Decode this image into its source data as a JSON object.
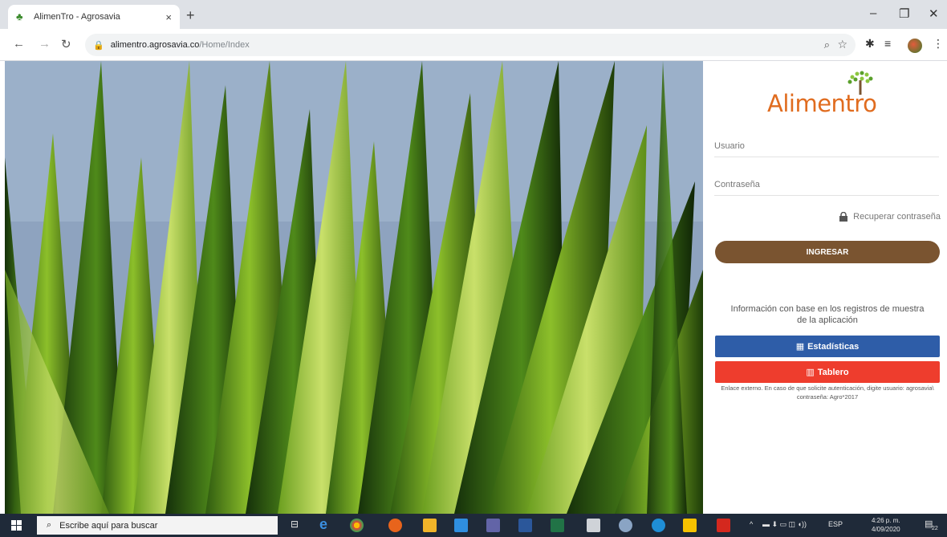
{
  "browser": {
    "tab_title": "AlimenTro - Agrosavia",
    "tab_close": "×",
    "new_tab": "+",
    "url_host": "alimentro.agrosavia.co",
    "url_path": "/Home/Index"
  },
  "login": {
    "logo_text": "Alimentro",
    "username_placeholder": "Usuario",
    "password_placeholder": "Contraseña",
    "recover_label": "Recuperar contraseña",
    "submit_label": "INGRESAR",
    "info_text": "Información con base en los registros de muestra de la aplicación",
    "stats_label": "Estadísticas",
    "dashboard_label": "Tablero",
    "note_text": "Enlace externo. En caso de que solicite autenticación, digite usuario: agrosavia\\ contraseña: Agro*2017"
  },
  "taskbar": {
    "search_placeholder": "Escribe aquí para buscar",
    "language": "ESP",
    "time": "4:26 p. m.",
    "date": "4/09/2020",
    "notif_count": "22"
  },
  "colors": {
    "logo": "#e06c1f",
    "ingresar": "#7a5430",
    "estadisticas": "#2e5da8",
    "tablero": "#ee3d2d"
  },
  "icons": [
    "favicon-icon",
    "back-icon",
    "forward-icon",
    "reload-icon",
    "lock-icon",
    "zoom-icon",
    "star-icon",
    "extension-icon",
    "media-icon",
    "profile-icon",
    "menu-icon",
    "windows-icon",
    "search-icon",
    "taskview-icon",
    "edge-icon",
    "chrome-icon",
    "table-icon",
    "chart-icon"
  ]
}
